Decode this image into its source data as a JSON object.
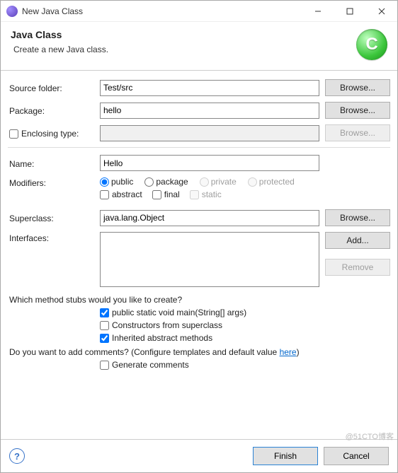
{
  "window": {
    "title": "New Java Class"
  },
  "banner": {
    "heading": "Java Class",
    "sub": "Create a new Java class.",
    "iconLetter": "C"
  },
  "labels": {
    "sourceFolder": "Source folder:",
    "package": "Package:",
    "enclosingType": "Enclosing type:",
    "name": "Name:",
    "modifiers": "Modifiers:",
    "superclass": "Superclass:",
    "interfaces": "Interfaces:"
  },
  "fields": {
    "sourceFolder": "Test/src",
    "package": "hello",
    "enclosingType": "",
    "name": "Hello",
    "superclass": "java.lang.Object",
    "interfaces": ""
  },
  "buttons": {
    "browse": "Browse...",
    "add": "Add...",
    "remove": "Remove",
    "finish": "Finish",
    "cancel": "Cancel"
  },
  "modifiers": {
    "public": "public",
    "package": "package",
    "private": "private",
    "protected": "protected",
    "abstract": "abstract",
    "final": "final",
    "static": "static"
  },
  "stubs": {
    "q": "Which method stubs would you like to create?",
    "main": "public static void main(String[] args)",
    "constructors": "Constructors from superclass",
    "inherited": "Inherited abstract methods"
  },
  "comments": {
    "q_pre": "Do you want to add comments? (Configure templates and default value ",
    "link": "here",
    "q_post": ")",
    "generate": "Generate comments"
  },
  "watermark": "@51CTO博客"
}
